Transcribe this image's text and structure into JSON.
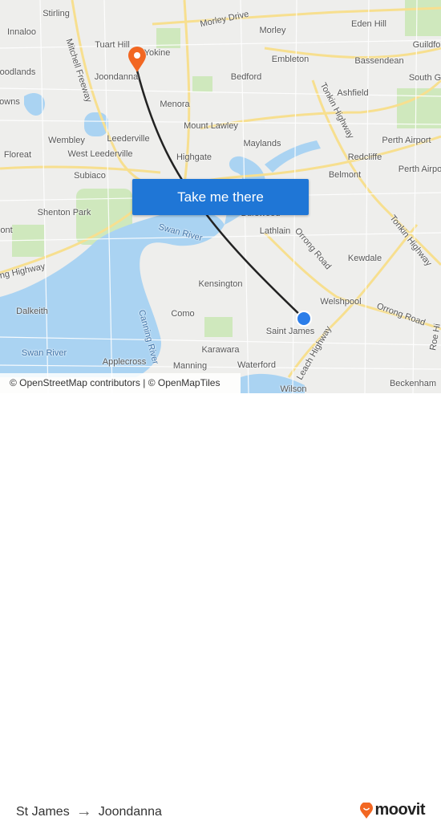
{
  "map": {
    "labels": {
      "stirling": "Stirling",
      "innaloo": "Innaloo",
      "tuart_hill": "Tuart Hill",
      "yokine": "Yokine",
      "joondanna": "Joondanna",
      "morley_drive": "Morley Drive",
      "morley": "Morley",
      "eden_hill": "Eden Hill",
      "guildford": "Guildfo",
      "embleton": "Embleton",
      "bassendean": "Bassendean",
      "bedford": "Bedford",
      "woodlands": "oodlands",
      "south_g": "South G",
      "ashfield": "Ashfield",
      "menora": "Menora",
      "towns": "owns",
      "mount_lawley": "Mount Lawley",
      "maylands": "Maylands",
      "tonkin_hwy_1": "Tonkin Highway",
      "wembley": "Wembley",
      "leederville": "Leederville",
      "perth_airport_1": "Perth Airport",
      "west_leederville": "West Leederville",
      "highgate": "Highgate",
      "redcliffe": "Redcliffe",
      "floreat": "Floreat",
      "belmont": "Belmont",
      "perth_airport_2": "Perth Airpo",
      "subiaco": "Subiaco",
      "shenton_park": "Shenton Park",
      "burswood": "Burswood",
      "lathlain": "Lathlain",
      "swan_river_1": "Swan River",
      "orrong_road_1": "Orrong Road",
      "kewdale": "Kewdale",
      "tonkin_hwy_2": "Tonkin Highway",
      "stirling_hwy": "ng Highway",
      "kensington": "Kensington",
      "dalkeith": "Dalkeith",
      "welshpool": "Welshpool",
      "orrong_road_2": "Orrong Road",
      "como": "Como",
      "saint_james": "Saint James",
      "roe_hwy": "Roe Hi",
      "leach_hwy": "Leach Highway",
      "canning_river": "Canning River",
      "swan_river_2": "Swan River",
      "karawara": "Karawara",
      "applecross": "Applecross",
      "manning": "Manning",
      "waterford": "Waterford",
      "beckenham": "Beckenham",
      "wilson": "Wilson",
      "mitchell_fwy": "Mitchell Freeway",
      "mont": "ont"
    },
    "cta_label": "Take me there",
    "attribution": "© OpenStreetMap contributors | © OpenMapTiles",
    "colors": {
      "route": "#222222",
      "origin": "#2b7de9",
      "destination": "#f26722",
      "button": "#1f76d6",
      "water": "#aad3f2",
      "road": "#fbe7a1",
      "park": "#c9e6b4"
    }
  },
  "footer": {
    "origin": "St James",
    "arrow": "→",
    "destination": "Joondanna",
    "logo_text": "moovit"
  }
}
